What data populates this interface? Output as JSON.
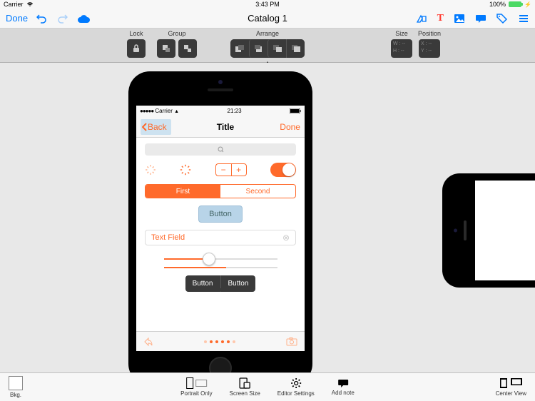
{
  "ipad_status": {
    "carrier": "Carrier",
    "wifi": true,
    "time": "3:43 PM",
    "battery_text": "100%"
  },
  "top_bar": {
    "done": "Done",
    "title": "Catalog 1"
  },
  "editor_toolbar": {
    "lock_label": "Lock",
    "group_label": "Group",
    "arrange_label": "Arrange",
    "size_label": "Size",
    "position_label": "Position",
    "size_w": "W :",
    "size_h": "H :",
    "pos_x": "X :",
    "pos_y": "Y :"
  },
  "phone": {
    "status": {
      "carrier": "Carrier",
      "time": "21:23"
    },
    "nav": {
      "back": "Back",
      "title": "Title",
      "done": "Done"
    },
    "search_placeholder": "",
    "segmented": {
      "first": "First",
      "second": "Second"
    },
    "button_label": "Button",
    "textfield_placeholder": "Text Field",
    "pair": {
      "a": "Button",
      "b": "Button"
    }
  },
  "bottom": {
    "bkg": "Bkg.",
    "portrait": "Portrait Only",
    "screen_size": "Screen Size",
    "editor_settings": "Editor Settings",
    "add_note": "Add note",
    "center_view": "Center View"
  }
}
